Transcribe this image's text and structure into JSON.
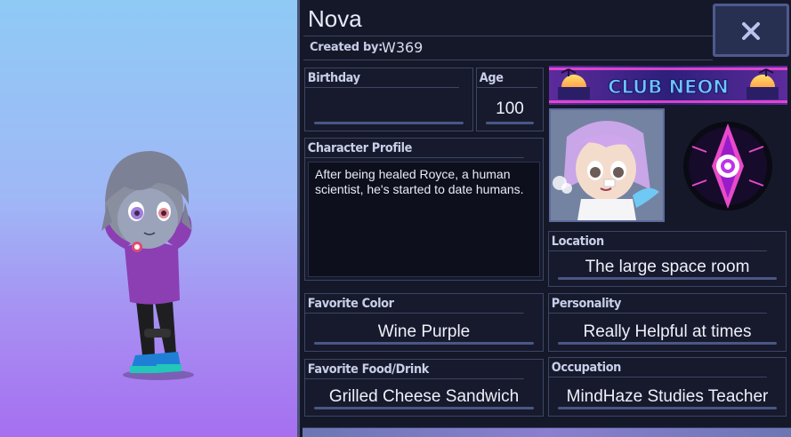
{
  "character": {
    "name": "Nova",
    "created_by_label": "Created by:",
    "created_by_value": "W369"
  },
  "close_button": {
    "label": "X"
  },
  "fields": {
    "birthday": {
      "label": "Birthday",
      "value": ""
    },
    "age": {
      "label": "Age",
      "value": "100"
    },
    "profile": {
      "label": "Character Profile",
      "text": "After being healed Royce, a human scientist, he's started to date humans."
    },
    "favorite_color": {
      "label": "Favorite Color",
      "value": "Wine Purple"
    },
    "favorite_food": {
      "label": "Favorite Food/Drink",
      "value": "Grilled Cheese Sandwich"
    },
    "location": {
      "label": "Location",
      "value": "The large space room"
    },
    "personality": {
      "label": "Personality",
      "value": "Really Helpful at times"
    },
    "occupation": {
      "label": "Occupation",
      "value": "MindHaze Studies Teacher"
    }
  },
  "banner": {
    "text": "CLUB NEON"
  },
  "colors": {
    "panel_bg": "#151829",
    "panel_border": "#3d4566",
    "label_text": "#c9cfe9",
    "value_text": "#eef0fa",
    "background_top": "#8fcaf5",
    "background_bottom": "#a66ff0"
  },
  "icons": [
    "close-icon",
    "palm-tree-icon",
    "sunset-icon",
    "emblem-eye-icon"
  ]
}
